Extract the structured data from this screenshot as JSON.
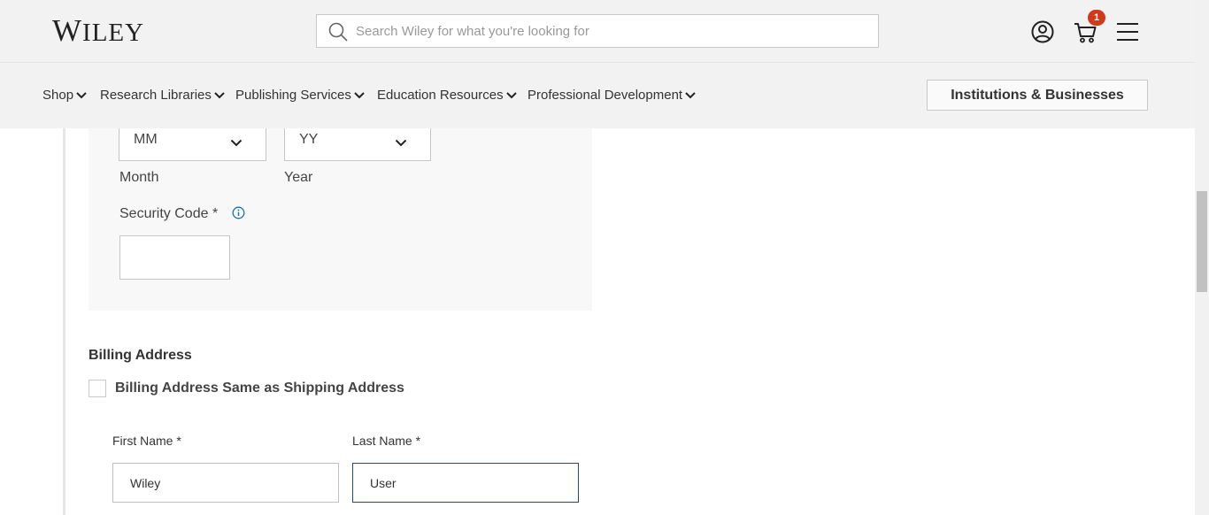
{
  "header": {
    "logo_big": "W",
    "logo_small": "ILEY",
    "search_placeholder": "Search Wiley for what you're looking for",
    "cart_count": "1",
    "icons": [
      "search-icon",
      "account-icon",
      "cart-icon",
      "menu-icon"
    ]
  },
  "nav": {
    "items": [
      {
        "label": "Shop"
      },
      {
        "label": "Research Libraries"
      },
      {
        "label": "Publishing Services"
      },
      {
        "label": "Education Resources"
      },
      {
        "label": "Professional Development"
      }
    ],
    "institutions_label": "Institutions & Businesses"
  },
  "payment": {
    "month_value": "MM",
    "month_label": "Month",
    "year_value": "YY",
    "year_label": "Year",
    "security_code_label": "Security Code *"
  },
  "billing": {
    "title": "Billing Address",
    "same_as_shipping_label": "Billing Address Same as Shipping Address",
    "first_name_label": "First Name *",
    "first_name_value": "Wiley",
    "last_name_label": "Last Name *",
    "last_name_value": "User"
  },
  "colors": {
    "header_bg": "#f2f2f2",
    "badge": "#d0391c",
    "focus_border": "#1f4a7a",
    "info_icon": "#1a6fb5"
  }
}
